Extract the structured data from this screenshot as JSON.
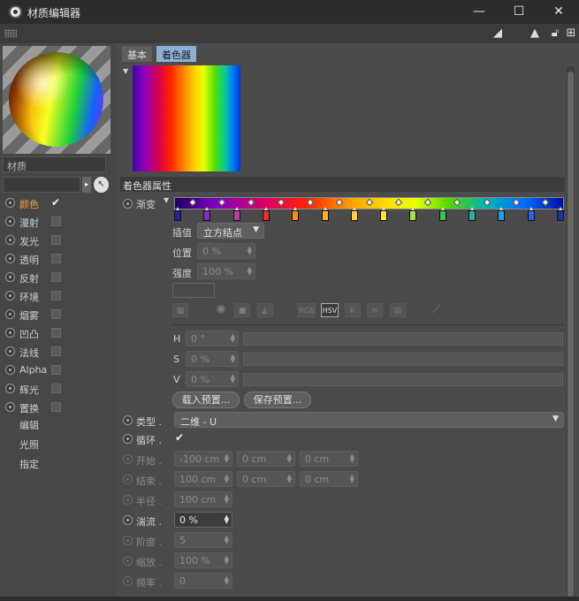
{
  "window": {
    "title": "材质编辑器",
    "minimize": "—",
    "maximize": "☐",
    "close": "✕"
  },
  "toolbar": {
    "icons": [
      "arrow-icon",
      "navigate-icon",
      "lock-icon",
      "new-window-icon"
    ]
  },
  "left": {
    "material_name": "材质",
    "channels": [
      {
        "label": "颜色",
        "checked": true,
        "active": true
      },
      {
        "label": "漫射",
        "checked": false
      },
      {
        "label": "发光",
        "checked": false
      },
      {
        "label": "透明",
        "checked": false
      },
      {
        "label": "反射",
        "checked": false
      },
      {
        "label": "环境",
        "checked": false
      },
      {
        "label": "烟雾",
        "checked": false
      },
      {
        "label": "凹凸",
        "checked": false
      },
      {
        "label": "法线",
        "checked": false
      },
      {
        "label": "Alpha",
        "checked": false
      },
      {
        "label": "辉光",
        "checked": false
      },
      {
        "label": "置换",
        "checked": false
      }
    ],
    "extras": [
      "编辑",
      "光照",
      "指定"
    ]
  },
  "main": {
    "tabs": [
      "基本",
      "着色器"
    ],
    "section_title": "着色器属性",
    "gradient_label": "渐变",
    "interp_label": "插值",
    "interp_value": "立方结点",
    "position_label": "位置",
    "position_value": "0 %",
    "intensity_label": "强度",
    "intensity_value": "100 %",
    "h_label": "H",
    "h_value": "0 °",
    "s_label": "S",
    "s_value": "0 %",
    "v_label": "V",
    "v_value": "0 %",
    "load_preset": "载入预置...",
    "save_preset": "保存预置...",
    "type_label": "类型 .",
    "type_value": "二维 - U",
    "cycle_label": "循环 .",
    "start_label": "开始 .",
    "start_values": [
      "-100 cm",
      "0 cm",
      "0 cm"
    ],
    "end_label": "结束 .",
    "end_values": [
      "100 cm",
      "0 cm",
      "0 cm"
    ],
    "radius_label": "半径 .",
    "radius_value": "100 cm",
    "turbulence_label": "湍流 .",
    "turbulence_value": "0 %",
    "octaves_label": "阶度 .",
    "octaves_value": "5",
    "scale_label": "缩放 .",
    "scale_value": "100 %",
    "frequency_label": "频率 .",
    "frequency_value": "0",
    "icon_labels": [
      "RGB",
      "HSV"
    ],
    "knot_colors": [
      "#2b1fa0",
      "#8a2bc0",
      "#c03a9a",
      "#e03030",
      "#ff8a1a",
      "#ffb020",
      "#ffd030",
      "#ffe040",
      "#a8e040",
      "#40c050",
      "#20b0a0",
      "#20a0e0",
      "#3060e0",
      "#2030a0"
    ]
  }
}
